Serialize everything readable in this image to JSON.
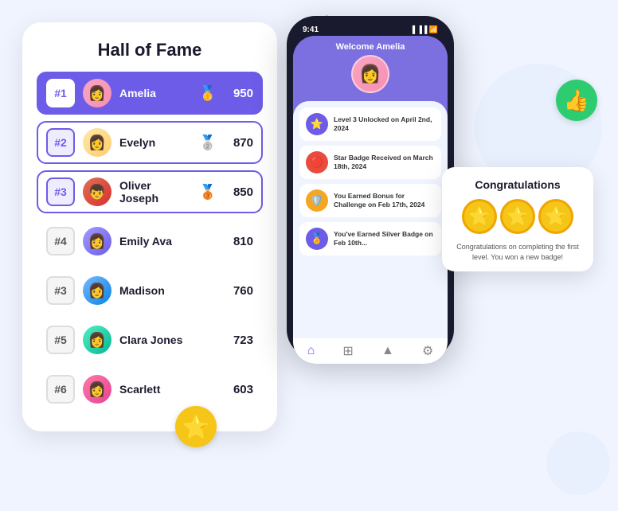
{
  "background": {
    "color": "#f0f4ff"
  },
  "hof": {
    "title": "Hall of Fame",
    "rows": [
      {
        "rank": "#1",
        "name": "Amelia",
        "score": "950",
        "medal": "🥇",
        "style": "highlight",
        "rankStyle": "purple",
        "avatar": "av-amelia"
      },
      {
        "rank": "#2",
        "name": "Evelyn",
        "score": "870",
        "medal": "🥈",
        "style": "bordered",
        "rankStyle": "purple-border",
        "avatar": "av-evelyn"
      },
      {
        "rank": "#3",
        "name": "Oliver Joseph",
        "score": "850",
        "medal": "🥉",
        "style": "bordered",
        "rankStyle": "purple-border",
        "avatar": "av-oliver"
      },
      {
        "rank": "#4",
        "name": "Emily Ava",
        "score": "810",
        "medal": "",
        "style": "plain",
        "rankStyle": "gray",
        "avatar": "av-emily"
      },
      {
        "rank": "#3",
        "name": "Madison",
        "score": "760",
        "medal": "",
        "style": "plain",
        "rankStyle": "gray",
        "avatar": "av-madison"
      },
      {
        "rank": "#5",
        "name": "Clara Jones",
        "score": "723",
        "medal": "",
        "style": "plain",
        "rankStyle": "gray",
        "avatar": "av-clara"
      },
      {
        "rank": "#6",
        "name": "Scarlett",
        "score": "603",
        "medal": "",
        "style": "plain",
        "rankStyle": "gray",
        "avatar": "av-scarlett"
      }
    ]
  },
  "phone": {
    "time": "9:41",
    "welcome": "Welcome Amelia",
    "activities": [
      {
        "icon": "⭐",
        "text": "Level 3 Unlocked on April 2nd, 2024",
        "bg": "#6c5ce7"
      },
      {
        "icon": "🔴",
        "text": "Star Badge Received on March 18th, 2024",
        "bg": "#e74c3c"
      },
      {
        "icon": "🛡️",
        "text": "You Earned Bonus for Challenge on Feb 17th, 2024",
        "bg": "#f5a623"
      },
      {
        "icon": "🏅",
        "text": "You've Earned Silver Badge on Feb 10th...",
        "bg": "#6c5ce7"
      }
    ]
  },
  "congrats": {
    "title": "Congratulations",
    "stars": [
      "⭐",
      "⭐",
      "⭐"
    ],
    "text": "Congratulations on completing the first level. You won a new badge!"
  },
  "decorations": {
    "thumbs_up": "👍",
    "star": "⭐"
  }
}
